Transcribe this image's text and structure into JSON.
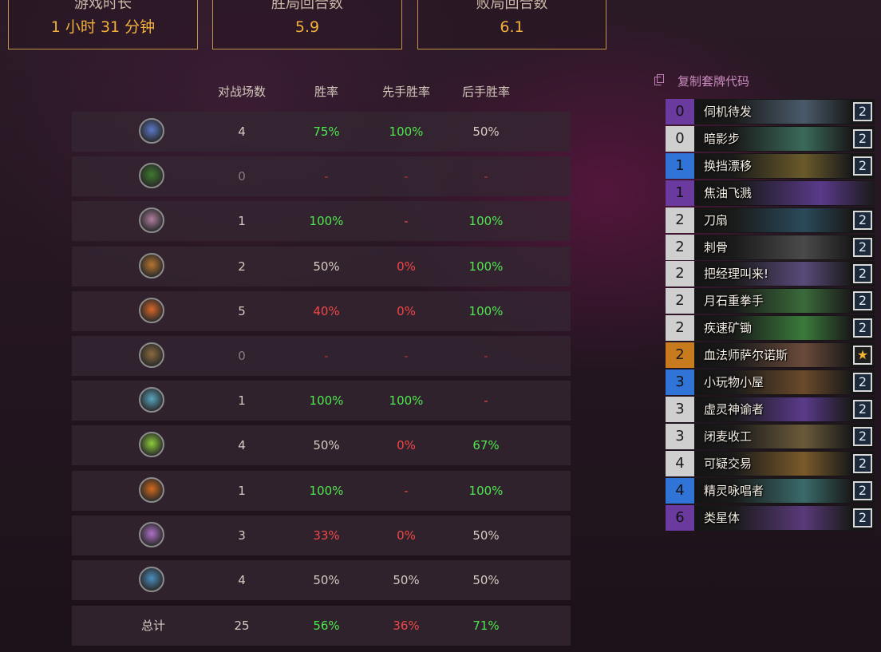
{
  "stats": [
    {
      "label": "游戏时长",
      "value": "1 小时 31 分钟"
    },
    {
      "label": "胜局回合数",
      "value": "5.9"
    },
    {
      "label": "败局回合数",
      "value": "6.1"
    }
  ],
  "table": {
    "headers": [
      "对战场数",
      "胜率",
      "先手胜率",
      "后手胜率"
    ],
    "rows": [
      {
        "icon": "mage-class-icon",
        "color": "#5b78c8",
        "games": "4",
        "winrate": "75%",
        "first": "100%",
        "second": "50%",
        "styles": [
          "neutral",
          "green",
          "green",
          "neutral"
        ]
      },
      {
        "icon": "druid-class-icon",
        "color": "#3e7a2e",
        "games": "0",
        "winrate": "-",
        "first": "-",
        "second": "-",
        "styles": [
          "dim",
          "dimred",
          "dimred",
          "dimred"
        ]
      },
      {
        "icon": "shaman-class-icon",
        "color": "#b07fa0",
        "games": "1",
        "winrate": "100%",
        "first": "-",
        "second": "100%",
        "styles": [
          "neutral",
          "green",
          "red",
          "green"
        ]
      },
      {
        "icon": "hunter-class-icon",
        "color": "#b8752e",
        "games": "2",
        "winrate": "50%",
        "first": "0%",
        "second": "100%",
        "styles": [
          "neutral",
          "neutral",
          "red",
          "green"
        ]
      },
      {
        "icon": "warlock-class-icon",
        "color": "#d9662a",
        "games": "5",
        "winrate": "40%",
        "first": "0%",
        "second": "100%",
        "styles": [
          "neutral",
          "red",
          "red",
          "green"
        ]
      },
      {
        "icon": "paladin-class-icon",
        "color": "#8b6a3e",
        "games": "0",
        "winrate": "-",
        "first": "-",
        "second": "-",
        "styles": [
          "dim",
          "dimred",
          "dimred",
          "dimred"
        ]
      },
      {
        "icon": "priest-class-icon",
        "color": "#5aa6c0",
        "games": "1",
        "winrate": "100%",
        "first": "100%",
        "second": "-",
        "styles": [
          "neutral",
          "green",
          "green",
          "red"
        ]
      },
      {
        "icon": "demon-hunter-class-icon",
        "color": "#8ccd3a",
        "games": "4",
        "winrate": "50%",
        "first": "0%",
        "second": "67%",
        "styles": [
          "neutral",
          "neutral",
          "red",
          "green"
        ]
      },
      {
        "icon": "warrior-class-icon",
        "color": "#d46a1c",
        "games": "1",
        "winrate": "100%",
        "first": "-",
        "second": "100%",
        "styles": [
          "neutral",
          "green",
          "red",
          "green"
        ]
      },
      {
        "icon": "rogue-class-icon",
        "color": "#b070c8",
        "games": "3",
        "winrate": "33%",
        "first": "0%",
        "second": "50%",
        "styles": [
          "neutral",
          "red",
          "red",
          "neutral"
        ]
      },
      {
        "icon": "death-knight-class-icon",
        "color": "#4a8fc0",
        "games": "4",
        "winrate": "50%",
        "first": "50%",
        "second": "50%",
        "styles": [
          "neutral",
          "neutral",
          "neutral",
          "neutral"
        ]
      }
    ],
    "total": {
      "label": "总计",
      "games": "25",
      "winrate": "56%",
      "first": "36%",
      "second": "71%",
      "styles": [
        "neutral",
        "green",
        "red",
        "green"
      ]
    }
  },
  "deck": {
    "copy_label": "复制套牌代码",
    "cards": [
      {
        "cost": "0",
        "name": "伺机待发",
        "count": "2",
        "rarity": "purple",
        "art": "#4a5a6a"
      },
      {
        "cost": "0",
        "name": "暗影步",
        "count": "2",
        "rarity": "white",
        "art": "#3a6a5a"
      },
      {
        "cost": "1",
        "name": "换挡漂移",
        "count": "2",
        "rarity": "blue",
        "art": "#6a5a2a"
      },
      {
        "cost": "1",
        "name": "焦油飞溅",
        "count": "",
        "rarity": "purple",
        "art": "#5a3a8a"
      },
      {
        "cost": "2",
        "name": "刀扇",
        "count": "2",
        "rarity": "white",
        "art": "#2a4a5a"
      },
      {
        "cost": "2",
        "name": "刺骨",
        "count": "2",
        "rarity": "white",
        "art": "#4a4a4a"
      },
      {
        "cost": "2",
        "name": "把经理叫来!",
        "count": "2",
        "rarity": "white",
        "art": "#5a4a7a"
      },
      {
        "cost": "2",
        "name": "月石重拳手",
        "count": "2",
        "rarity": "white",
        "art": "#3a6a3a"
      },
      {
        "cost": "2",
        "name": "疾速矿锄",
        "count": "2",
        "rarity": "white",
        "art": "#3a7a3a"
      },
      {
        "cost": "2",
        "name": "血法师萨尔诺斯",
        "count": "★",
        "rarity": "orange",
        "art": "#6a4a3a"
      },
      {
        "cost": "3",
        "name": "小玩物小屋",
        "count": "2",
        "rarity": "blue",
        "art": "#6a4a2a"
      },
      {
        "cost": "3",
        "name": "虚灵神谕者",
        "count": "2",
        "rarity": "white",
        "art": "#5a3a8a"
      },
      {
        "cost": "3",
        "name": "闭麦收工",
        "count": "2",
        "rarity": "white",
        "art": "#6a5a3a"
      },
      {
        "cost": "4",
        "name": "可疑交易",
        "count": "2",
        "rarity": "white",
        "art": "#7a5a2a"
      },
      {
        "cost": "4",
        "name": "精灵咏唱者",
        "count": "2",
        "rarity": "blue",
        "art": "#3a6a6a"
      },
      {
        "cost": "6",
        "name": "类星体",
        "count": "2",
        "rarity": "purple",
        "art": "#5a3a7a"
      }
    ]
  }
}
